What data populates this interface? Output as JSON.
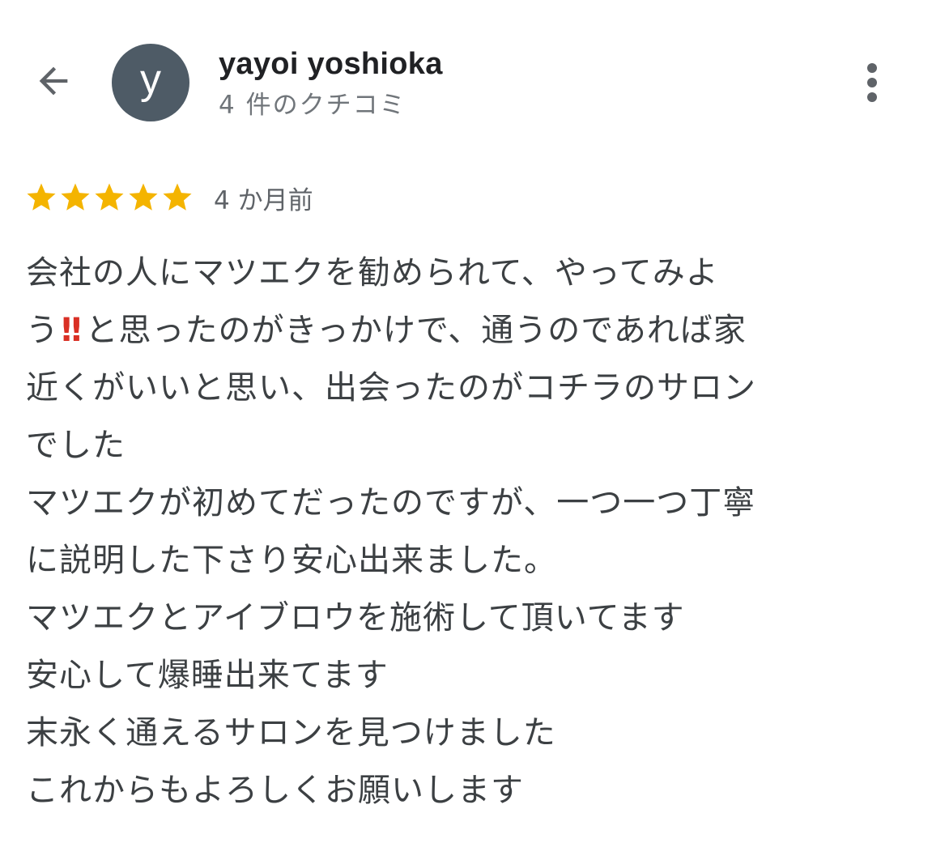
{
  "header": {
    "back_icon": "arrow-back-icon",
    "avatar_letter": "y",
    "avatar_color": "#4e5b66",
    "user_name": "yayoi yoshioka",
    "review_count": "4 件のクチコミ",
    "more_icon": "more-vert-icon"
  },
  "review": {
    "rating": 5,
    "rating_max": 5,
    "star_color": "#f4b400",
    "date": "4 か月前",
    "lines": [
      "会社の人にマツエクを勧められて、やってみよ",
      "う‼️と思ったのがきっかけで、通うのであれば家",
      "近くがいいと思い、出会ったのがコチラのサロン",
      "でした",
      "マツエクが初めてだったのですが、一つ一つ丁寧",
      "に説明した下さり安心出来ました。",
      "マツエクとアイブロウを施術して頂いてます",
      "安心して爆睡出来てます",
      "末永く通えるサロンを見つけました",
      "これからもよろしくお願いします"
    ]
  }
}
